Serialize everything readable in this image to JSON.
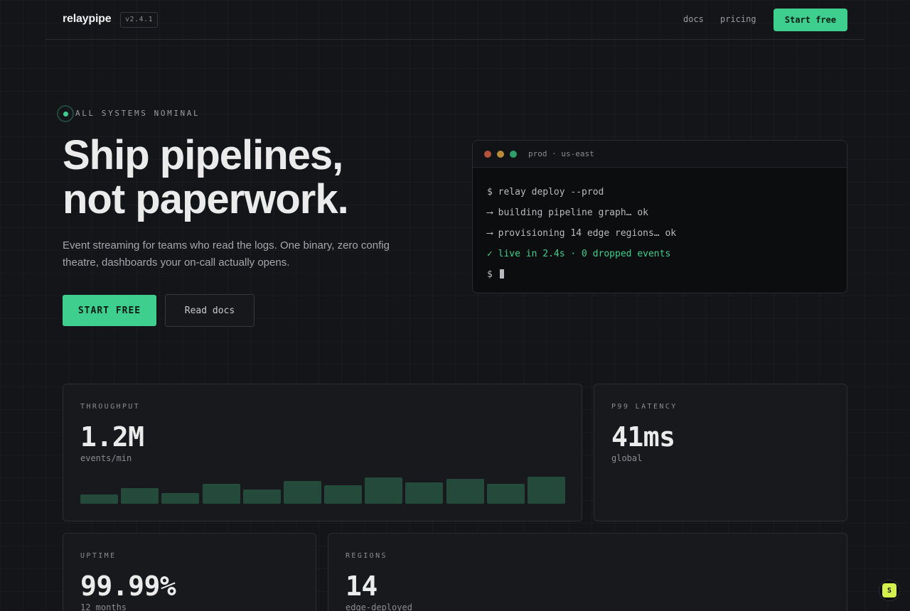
{
  "header": {
    "logo": "relaypipe",
    "version": "v2.4.1",
    "nav": {
      "docs": "docs",
      "pricing": "pricing"
    },
    "cta": "Start free"
  },
  "hero": {
    "status": "ALL SYSTEMS NOMINAL",
    "title_line1": "Ship pipelines,",
    "title_line2": "not paperwork.",
    "subtitle": "Event streaming for teams who read the logs. One binary, zero config theatre, dashboards your on-call actually opens.",
    "primary_button": "START FREE",
    "secondary_button": "Read docs"
  },
  "terminal": {
    "title": "prod · us-east",
    "lines": [
      "$ relay deploy --prod",
      "⟶ building pipeline graph… ok",
      "⟶ provisioning 14 edge regions… ok",
      "✓ live in 2.4s · 0 dropped events",
      "$"
    ]
  },
  "stats": {
    "throughput": {
      "label": "THROUGHPUT",
      "value": "1.2M",
      "unit": "events/min",
      "sparkline": [
        0.33,
        0.55,
        0.38,
        0.7,
        0.5,
        0.8,
        0.65,
        0.92,
        0.75,
        0.88,
        0.7,
        0.95
      ]
    },
    "latency": {
      "label": "P99 LATENCY",
      "value": "41ms",
      "unit": "global"
    },
    "uptime": {
      "label": "UPTIME",
      "value": "99.99%",
      "unit": "12 months"
    },
    "regions": {
      "label": "REGIONS",
      "value": "14",
      "unit": "edge-deployed"
    }
  },
  "badge": {
    "label": "S"
  },
  "colors": {
    "accent": "#3ecf8e",
    "background": "#131518",
    "card": "#17191c"
  }
}
